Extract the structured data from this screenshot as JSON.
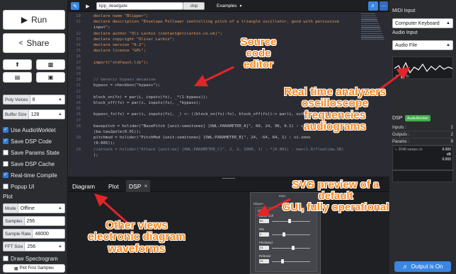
{
  "left": {
    "run_label": "Run",
    "share_label": "Share",
    "poly_voices": {
      "label": "Poly Voices",
      "value": "8"
    },
    "buffer_size": {
      "label": "Buffer Size",
      "value": "128"
    },
    "checkboxes": [
      {
        "label": "Use AudioWorklet",
        "checked": true
      },
      {
        "label": "Save DSP Code",
        "checked": true
      },
      {
        "label": "Save Params State",
        "checked": false
      },
      {
        "label": "Save DSP Cache",
        "checked": false
      },
      {
        "label": "Real-time Compile",
        "checked": true
      },
      {
        "label": "Popup UI",
        "checked": false
      }
    ],
    "plot_title": "Plot",
    "mode": {
      "label": "Mode",
      "value": "Offline"
    },
    "samples": {
      "label": "Samples",
      "value": "256"
    },
    "sample_rate": {
      "label": "Sample Rate",
      "value": "48000"
    },
    "fft_size": {
      "label": "FFT Size",
      "value": "256"
    },
    "draw_spectrogram": {
      "label": "Draw Spectrogram",
      "checked": false
    },
    "plot_first_label": "Plot First Samples"
  },
  "topbar": {
    "filename": "kpp_deadgate",
    "extension": ".dsp",
    "examples_label": "Examples"
  },
  "editor": {
    "lines": [
      {
        "n": "10",
        "text": "declare name \"Blipper\";"
      },
      {
        "n": "11",
        "text": "declare description \"Envelope Follower controlling pitch of a triangle oscillator, good with percussive"
      },
      {
        "n": "",
        "text": "input\";"
      },
      {
        "n": "12",
        "text": "declare author \"Oli Larkin (contact@olilarkin.co.uk)\";"
      },
      {
        "n": "13",
        "text": "declare copyright \"Oliver Larkin\";"
      },
      {
        "n": "14",
        "text": "declare version \"0.2\";"
      },
      {
        "n": "15",
        "text": "declare licence \"GPL\";"
      },
      {
        "n": "16",
        "text": ""
      },
      {
        "n": "17",
        "text": "import(\"stdfaust.lib\");"
      },
      {
        "n": "18",
        "text": ""
      },
      {
        "n": "19",
        "text": ""
      },
      {
        "n": "10",
        "text": "// Generic bypass mecanism"
      },
      {
        "n": "11",
        "text": "bypass = checkbox(\"bypass\");"
      },
      {
        "n": "12",
        "text": ""
      },
      {
        "n": "13",
        "text": "block_on(fx) = par(i, inputs(fx), _*(1-bypass));"
      },
      {
        "n": "14",
        "text": "block_off(fx) = par(i, inputs(fx), _*bypass);"
      },
      {
        "n": "15",
        "text": ""
      },
      {
        "n": "16",
        "text": "bypass_fx(fx) = par(i, inputs(fx), _) <: ((block_on(fx):fx), block_off(fx)):> par(i, outputs(fx), _);"
      },
      {
        "n": "17",
        "text": ""
      },
      {
        "n": "18",
        "text": "basepitch = hslider(\"BasePitch [unit:semitones] [OWL:PARAMETER_A]\", 60, 24, 96, 0.1) : si.smoo"
      },
      {
        "n": "",
        "text": "(ba.tau2pole(0.01));"
      },
      {
        "n": "19",
        "text": "pitchmod = hslider(\"PitchMod [unit:semitones] [OWL:PARAMETER_B]\", 24, -64, 64, 1) : si.smoo"
      },
      {
        "n": "",
        "text": "(0.005));"
      },
      {
        "n": "20",
        "text": "//attack = hslider(\"Attack [unit:ms] [OWL:PARAMETER_C]\", 2, 2, 1000, 1) : *(0.001) : max(1.0/float(ma.SR)"
      },
      {
        "n": "",
        "text": ");"
      }
    ]
  },
  "tabs": [
    {
      "label": "Diagram",
      "active": false
    },
    {
      "label": "Plot",
      "active": false
    },
    {
      "label": "DSP",
      "active": true
    }
  ],
  "gui": {
    "top_label": "Main",
    "group_label": "Blipper",
    "sliders": [
      {
        "label": "BasePitch",
        "value": "60",
        "pos": 0.45
      },
      {
        "label": "Mix",
        "value": "0",
        "pos": 0.3
      },
      {
        "label": "PitchMod",
        "value": "24",
        "pos": 0.55
      },
      {
        "label": "Release",
        "value": "20",
        "pos": 0.25
      }
    ]
  },
  "right": {
    "midi_input_label": "MIDI Input",
    "midi_input_value": "Computer Keyboard",
    "audio_input_label": "Audio Input",
    "audio_input_value": "Audio File",
    "dsp_label": "DSP",
    "dsp_badge": "AudioWorklet",
    "dsp_rows": [
      {
        "k": "Inputs :",
        "v": "2"
      },
      {
        "k": "Outputs :",
        "v": "2"
      },
      {
        "k": "Params :",
        "v": "9"
      }
    ],
    "scope_text": "2048 samps ch",
    "scope_vals": [
      "0.000",
      "0.000"
    ],
    "scope_unit": "dB",
    "output_label": "Output is On"
  },
  "annotations": {
    "editor": [
      "Source code",
      "editor"
    ],
    "analyzers": [
      "Real time analyzers",
      "oscilloscope",
      "frequencies",
      "audiograms"
    ],
    "svg": [
      "SVG preview of a default",
      "GUI, fully operational"
    ],
    "views": [
      "Other views",
      "electronic diagram",
      "waveforms"
    ]
  },
  "colors": {
    "annotation": "#ff8a1f",
    "accent": "#3a86e0",
    "panel": "#2a2c30"
  }
}
